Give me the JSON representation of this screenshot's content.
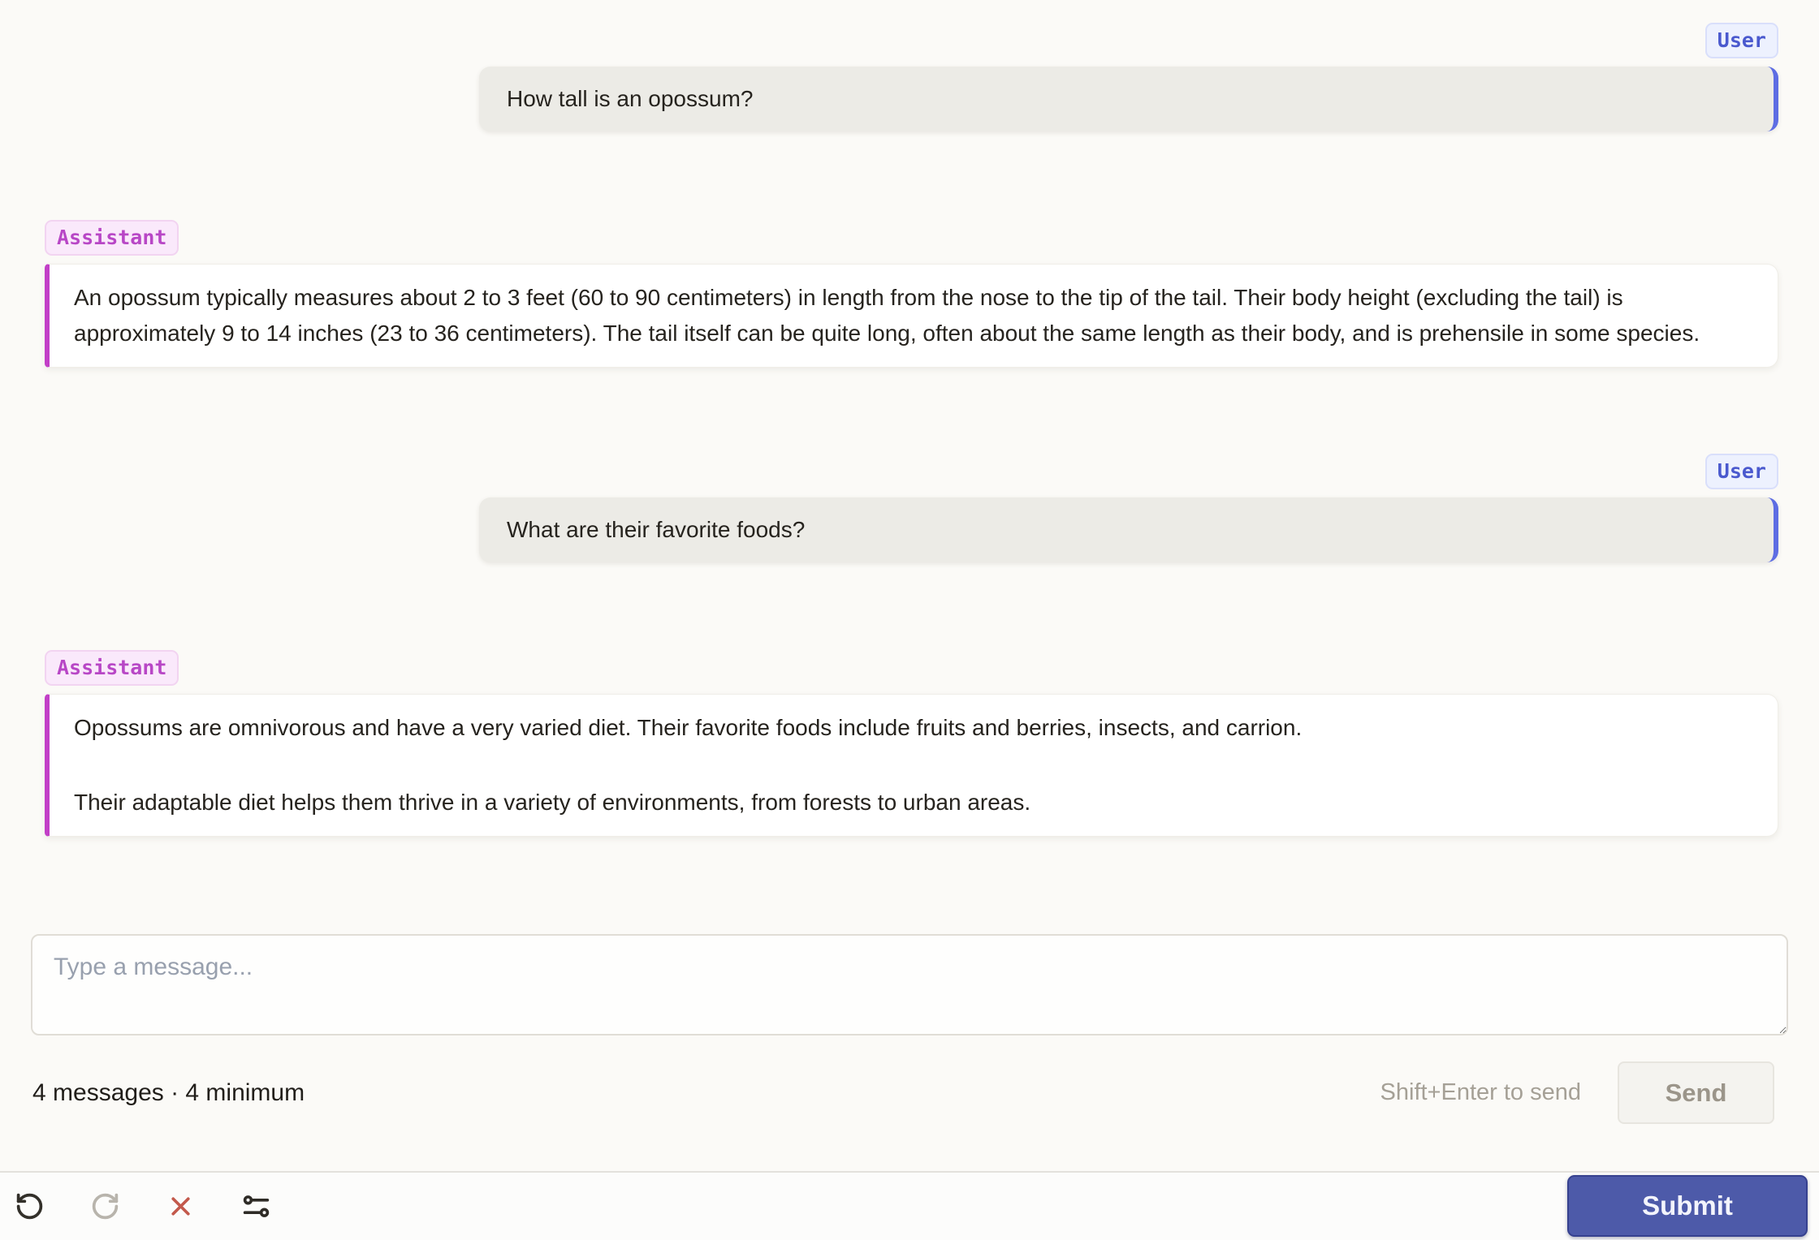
{
  "conversation": {
    "messages": [
      {
        "role": "User",
        "text": "How tall is an opossum?"
      },
      {
        "role": "Assistant",
        "paragraphs": [
          "An opossum typically measures about 2 to 3 feet (60 to 90 centimeters) in length from the nose to the tip of the tail. Their body height (excluding the tail) is approximately 9 to 14 inches (23 to 36 centimeters). The tail itself can be quite long, often about the same length as their body, and is prehensile in some species."
        ]
      },
      {
        "role": "User",
        "text": "What are their favorite foods?"
      },
      {
        "role": "Assistant",
        "paragraphs": [
          "Opossums are omnivorous and have a very varied diet. Their favorite foods include fruits and berries, insects, and carrion.",
          "Their adaptable diet helps them thrive in a variety of environments, from forests to urban areas."
        ]
      }
    ]
  },
  "composer": {
    "placeholder": "Type a message...",
    "value": "",
    "status": "4 messages · 4 minimum",
    "hint": "Shift+Enter to send",
    "send_label": "Send"
  },
  "footer": {
    "submit_label": "Submit",
    "icons": [
      "undo-icon",
      "redo-icon",
      "close-icon",
      "sliders-icon"
    ]
  },
  "colors": {
    "user_accent": "#5D6DE3",
    "assistant_accent": "#C23FC7",
    "user_badge_text": "#4A59CE",
    "assistant_badge_text": "#B847C6",
    "submit_bg": "#4D5AA9",
    "close_icon": "#C3594C",
    "page_bg": "#FBFAF7"
  }
}
